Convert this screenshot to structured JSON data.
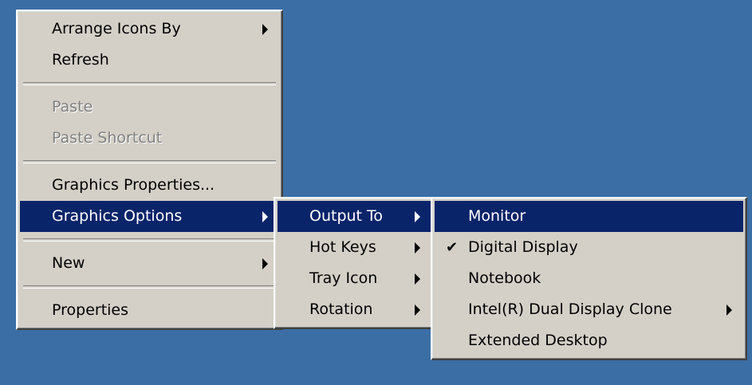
{
  "desktop": {
    "background_color": "#3a6ea5"
  },
  "context_menu": {
    "items": [
      {
        "label": "Arrange Icons By",
        "submenu": true
      },
      {
        "label": "Refresh"
      },
      {
        "label": "Paste",
        "disabled": true
      },
      {
        "label": "Paste Shortcut",
        "disabled": true
      },
      {
        "label": "Graphics Properties..."
      },
      {
        "label": "Graphics Options",
        "submenu": true,
        "highlighted": true
      },
      {
        "label": "New",
        "submenu": true
      },
      {
        "label": "Properties"
      }
    ]
  },
  "graphics_options_menu": {
    "items": [
      {
        "label": "Output To",
        "submenu": true,
        "highlighted": true
      },
      {
        "label": "Hot Keys",
        "submenu": true
      },
      {
        "label": "Tray Icon",
        "submenu": true
      },
      {
        "label": "Rotation",
        "submenu": true
      }
    ]
  },
  "output_to_menu": {
    "items": [
      {
        "label": "Monitor",
        "highlighted": true
      },
      {
        "label": "Digital Display",
        "checked": true,
        "check_icon": "✔"
      },
      {
        "label": "Notebook"
      },
      {
        "label": "Intel(R) Dual Display Clone",
        "submenu": true
      },
      {
        "label": "Extended Desktop"
      }
    ]
  },
  "colors": {
    "menu_bg": "#d4d0c8",
    "highlight_bg": "#0a246a",
    "highlight_text": "#ffffff",
    "disabled_text": "#808080"
  }
}
